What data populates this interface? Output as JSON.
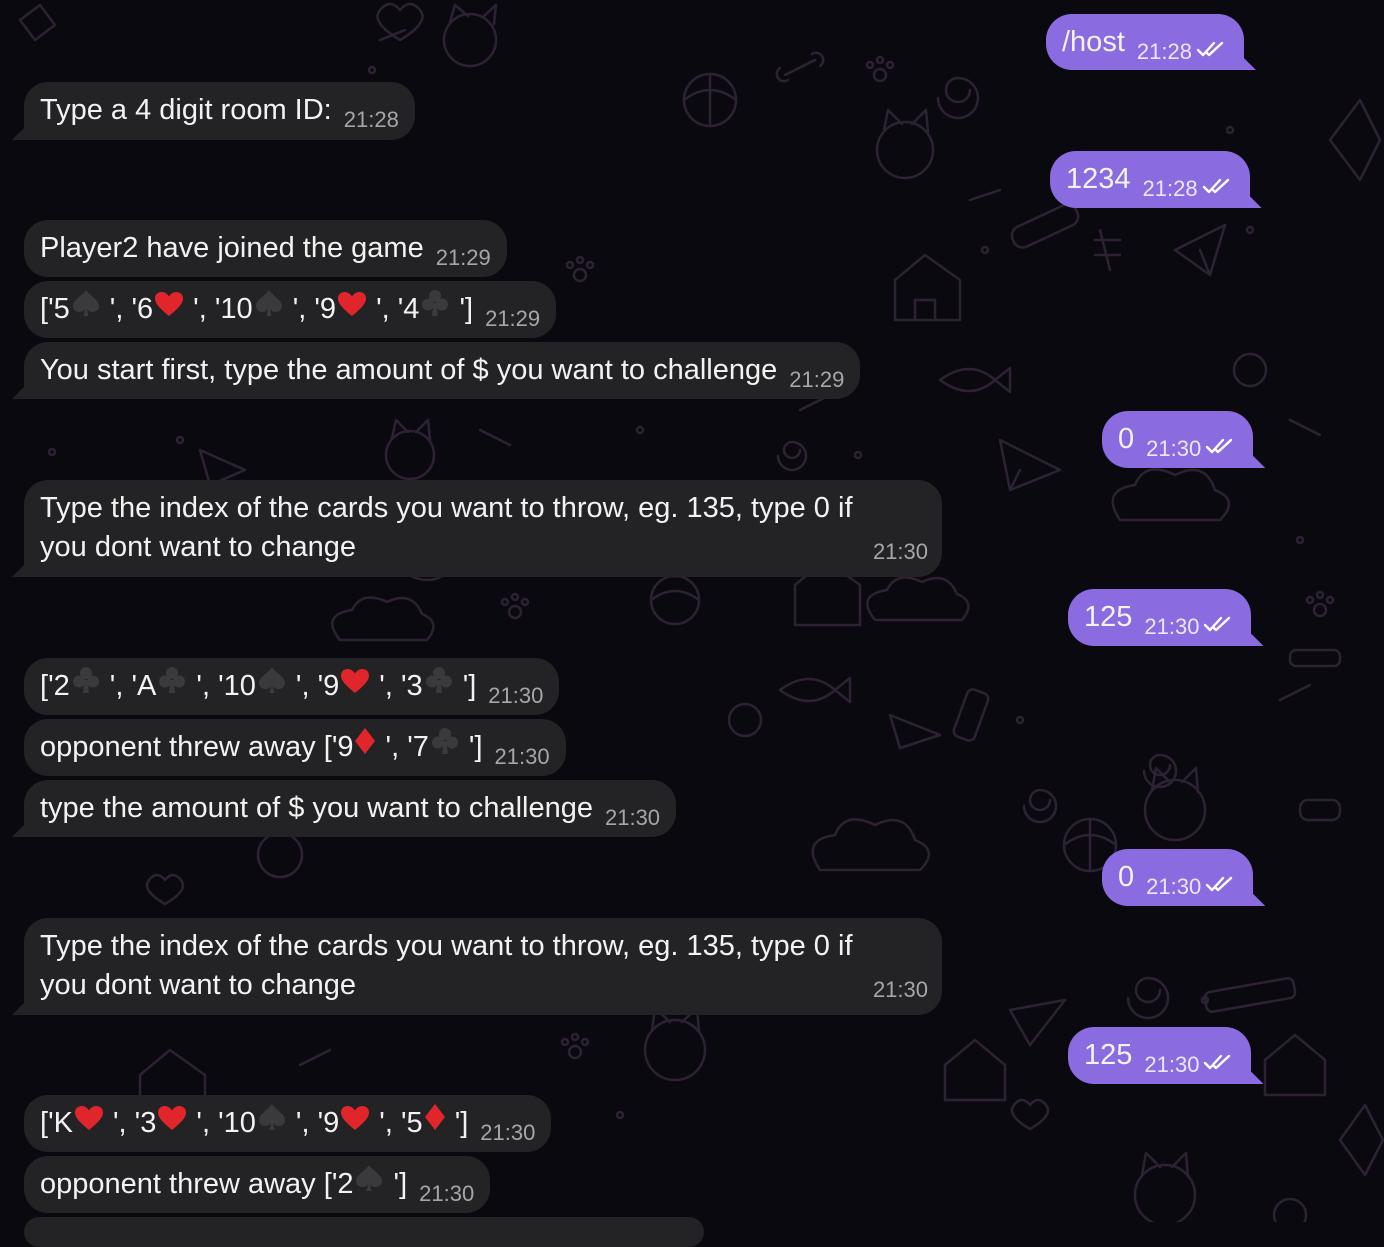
{
  "colors": {
    "background": "#0b0910",
    "incoming_bubble": "#232325",
    "outgoing_bubble": "#8b6be0",
    "heart": "#e0262b",
    "spade": "#3a3a3d"
  },
  "messages": [
    {
      "side": "out",
      "text": "/host",
      "time": "21:28",
      "status_icon": "double-check-icon"
    },
    {
      "side": "in",
      "text": "Type a 4 digit room ID:",
      "time": "21:28"
    },
    {
      "side": "out",
      "text": "1234",
      "time": "21:28",
      "status_icon": "double-check-icon"
    },
    {
      "side": "in",
      "text": "Player2 have joined the game",
      "time": "21:29"
    },
    {
      "side": "in",
      "cards": [
        "5♠",
        "6♥",
        "10♠",
        "9♥",
        "4♣"
      ],
      "time": "21:29"
    },
    {
      "side": "in",
      "text": "You start first, type the amount of $ you want to challenge",
      "time": "21:29"
    },
    {
      "side": "out",
      "text": "0",
      "time": "21:30",
      "status_icon": "double-check-icon"
    },
    {
      "side": "in",
      "text_line1": "Type the index of the cards you want to throw, eg. 135, type 0 if",
      "text_line2": "you dont want to change",
      "time": "21:30"
    },
    {
      "side": "out",
      "text": "125",
      "time": "21:30",
      "status_icon": "double-check-icon"
    },
    {
      "side": "in",
      "cards": [
        "2♣",
        "A♣",
        "10♠",
        "9♥",
        "3♣"
      ],
      "time": "21:30"
    },
    {
      "side": "in",
      "prefix": "opponent threw away ",
      "cards": [
        "9♦",
        "7♣"
      ],
      "time": "21:30"
    },
    {
      "side": "in",
      "text": "type the amount of $ you want to challenge",
      "time": "21:30"
    },
    {
      "side": "out",
      "text": "0",
      "time": "21:30",
      "status_icon": "double-check-icon"
    },
    {
      "side": "in",
      "text_line1": "Type the index of the cards you want to throw, eg. 135, type 0 if",
      "text_line2": "you dont want to change",
      "time": "21:30"
    },
    {
      "side": "out",
      "text": "125",
      "time": "21:30",
      "status_icon": "double-check-icon"
    },
    {
      "side": "in",
      "cards": [
        "K♥",
        "3♥",
        "10♠",
        "9♥",
        "5♦"
      ],
      "time": "21:30"
    },
    {
      "side": "in",
      "prefix": "opponent threw away ",
      "cards": [
        "2♠"
      ],
      "time": "21:30"
    }
  ]
}
